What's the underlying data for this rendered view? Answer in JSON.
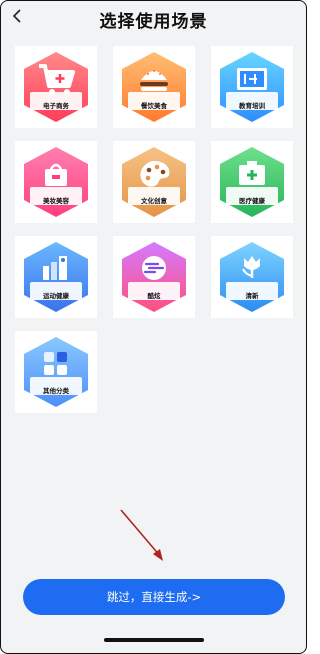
{
  "header": {
    "title": "选择使用场景",
    "back_icon": "chevron-left-icon"
  },
  "scenes": [
    {
      "label": "电子商务",
      "icon": "shopping-cart-icon",
      "color_top": "#ff8a8a",
      "color_bottom": "#ff3d5a"
    },
    {
      "label": "餐饮美食",
      "icon": "burger-icon",
      "color_top": "#ffbe73",
      "color_bottom": "#ff7a2e"
    },
    {
      "label": "教育培训",
      "icon": "blackboard-icon",
      "color_top": "#67d6ff",
      "color_bottom": "#2f8dff"
    },
    {
      "label": "美妆美容",
      "icon": "cosmetics-bag-icon",
      "color_top": "#ff7fb0",
      "color_bottom": "#ff3f7d"
    },
    {
      "label": "文化创意",
      "icon": "palette-icon",
      "color_top": "#f6c285",
      "color_bottom": "#e49448"
    },
    {
      "label": "医疗健康",
      "icon": "medical-kit-icon",
      "color_top": "#6ee08a",
      "color_bottom": "#27b45b"
    },
    {
      "label": "运动健康",
      "icon": "fitness-icon",
      "color_top": "#6ab7ff",
      "color_bottom": "#3a73ea"
    },
    {
      "label": "酷炫",
      "icon": "wave-circle-icon",
      "color_top": "#d37bff",
      "color_bottom": "#ff4f7e"
    },
    {
      "label": "清新",
      "icon": "tulip-icon",
      "color_top": "#7fd4ff",
      "color_bottom": "#2b8cf2"
    },
    {
      "label": "其他分类",
      "icon": "blocks-icon",
      "color_top": "#88c8ff",
      "color_bottom": "#4f8ff7"
    }
  ],
  "cta": {
    "label": "跳过，直接生成->",
    "color": "#1e6cf2"
  },
  "annotation": {
    "icon": "red-arrow-icon",
    "color": "#b22222"
  }
}
